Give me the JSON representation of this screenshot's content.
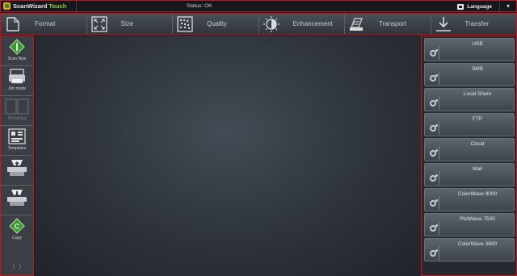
{
  "app": {
    "name": "ScanWizard",
    "accent": "Touch",
    "status": "Status: OK",
    "language": "Language"
  },
  "toolbar": {
    "items": [
      {
        "label": "Format",
        "icon": "format-icon"
      },
      {
        "label": "Size",
        "icon": "size-icon"
      },
      {
        "label": "Quality",
        "icon": "quality-icon"
      },
      {
        "label": "Enhancement",
        "icon": "enhancement-icon"
      },
      {
        "label": "Transport",
        "icon": "transport-icon"
      },
      {
        "label": "Transfer",
        "icon": "transfer-icon"
      }
    ]
  },
  "sidebar": {
    "items": [
      {
        "label": "Scan Now",
        "icon": "scan-now-icon"
      },
      {
        "label": "Job mode",
        "icon": "job-mode-icon"
      },
      {
        "label": "Mosaicing",
        "icon": "mosaicing-icon",
        "disabled": true
      },
      {
        "label": "Templates",
        "icon": "templates-icon"
      },
      {
        "label": "",
        "icon": "feed-up-icon"
      },
      {
        "label": "",
        "icon": "feed-down-icon"
      },
      {
        "label": "Copy",
        "icon": "copy-icon"
      }
    ]
  },
  "destinations": [
    {
      "label": "USB"
    },
    {
      "label": "SMB"
    },
    {
      "label": "Local Share"
    },
    {
      "label": "FTP"
    },
    {
      "label": "Cloud"
    },
    {
      "label": "Mail"
    },
    {
      "label": "ColorWave 9000"
    },
    {
      "label": "PlotWave 7500"
    },
    {
      "label": "ColorWave 3800"
    }
  ],
  "colors": {
    "highlight": "#c4161c",
    "brand_green": "#8ccf3c",
    "scan_green": "#2e8b2e"
  }
}
